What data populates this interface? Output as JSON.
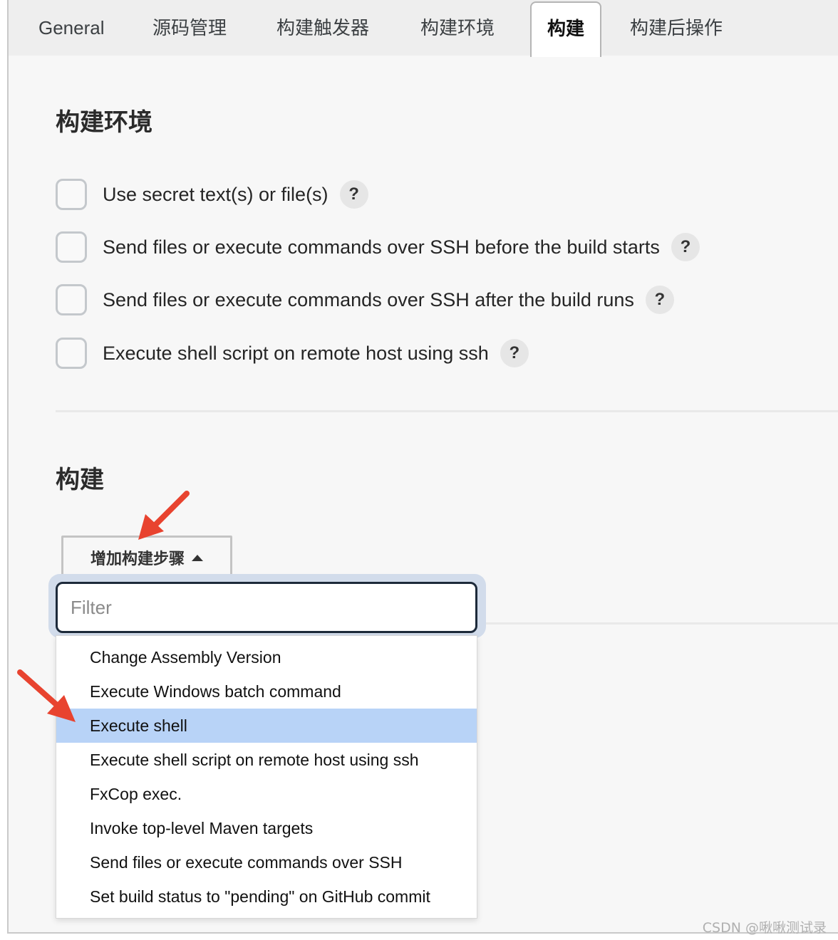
{
  "tabs": [
    {
      "label": "General"
    },
    {
      "label": "源码管理"
    },
    {
      "label": "构建触发器"
    },
    {
      "label": "构建环境"
    },
    {
      "label": "构建",
      "active": true
    },
    {
      "label": "构建后操作"
    }
  ],
  "build_env": {
    "title": "构建环境",
    "options": [
      {
        "label": "Use secret text(s) or file(s)",
        "checked": false,
        "help": "?"
      },
      {
        "label": "Send files or execute commands over SSH before the build starts",
        "checked": false,
        "help": "?"
      },
      {
        "label": "Send files or execute commands over SSH after the build runs",
        "checked": false,
        "help": "?"
      },
      {
        "label": "Execute shell script on remote host using ssh",
        "checked": false,
        "help": "?"
      }
    ]
  },
  "build": {
    "title": "构建",
    "add_step_label": "增加构建步骤",
    "filter_placeholder": "Filter",
    "filter_value": "",
    "menu_items": [
      {
        "label": "Change Assembly Version"
      },
      {
        "label": "Execute Windows batch command"
      },
      {
        "label": "Execute shell",
        "highlighted": true
      },
      {
        "label": "Execute shell script on remote host using ssh"
      },
      {
        "label": "FxCop exec."
      },
      {
        "label": "Invoke top-level Maven targets"
      },
      {
        "label": "Send files or execute commands over SSH"
      },
      {
        "label": "Set build status to \"pending\" on GitHub commit"
      }
    ]
  },
  "colors": {
    "highlight": "#b8d3f7",
    "annotation_arrow": "#e8432f"
  },
  "watermark": "CSDN @啾啾测试录"
}
